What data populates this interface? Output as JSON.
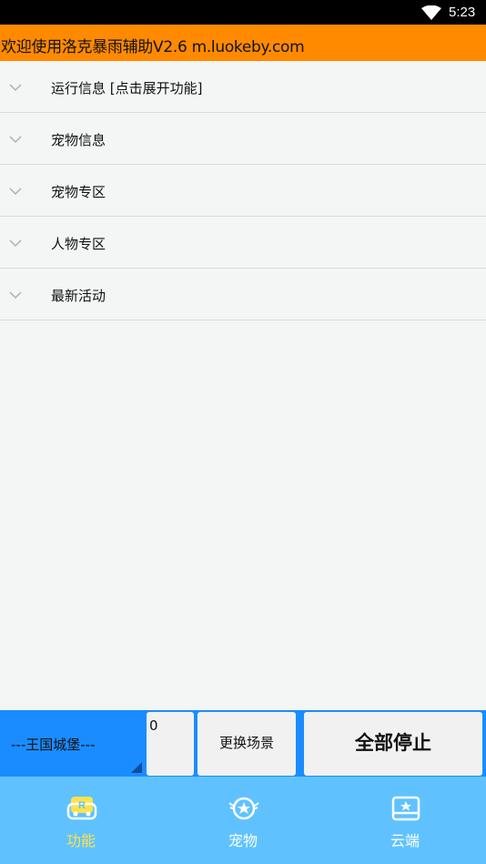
{
  "status_bar": {
    "time": "5:23"
  },
  "title_bar": {
    "title": "欢迎使用洛克暴雨辅助V2.6 m.luokeby.com"
  },
  "menu": {
    "items": [
      {
        "label": "运行信息 [点击展开功能]"
      },
      {
        "label": "宠物信息"
      },
      {
        "label": "宠物专区"
      },
      {
        "label": "人物专区"
      },
      {
        "label": "最新活动"
      }
    ]
  },
  "controls": {
    "scene_selected": "---王国城堡---",
    "count_value": "0",
    "change_scene_label": "更换场景",
    "stop_all_label": "全部停止"
  },
  "tabs": [
    {
      "label": "功能",
      "icon": "robot-icon",
      "active": true
    },
    {
      "label": "宠物",
      "icon": "pet-star-icon",
      "active": false
    },
    {
      "label": "云端",
      "icon": "cloud-card-icon",
      "active": false
    }
  ],
  "colors": {
    "title_bar": "#ff8a00",
    "controls_bg": "#1a8cff",
    "tab_bar": "#5fc2ff",
    "active_tab": "#ffe24a"
  }
}
